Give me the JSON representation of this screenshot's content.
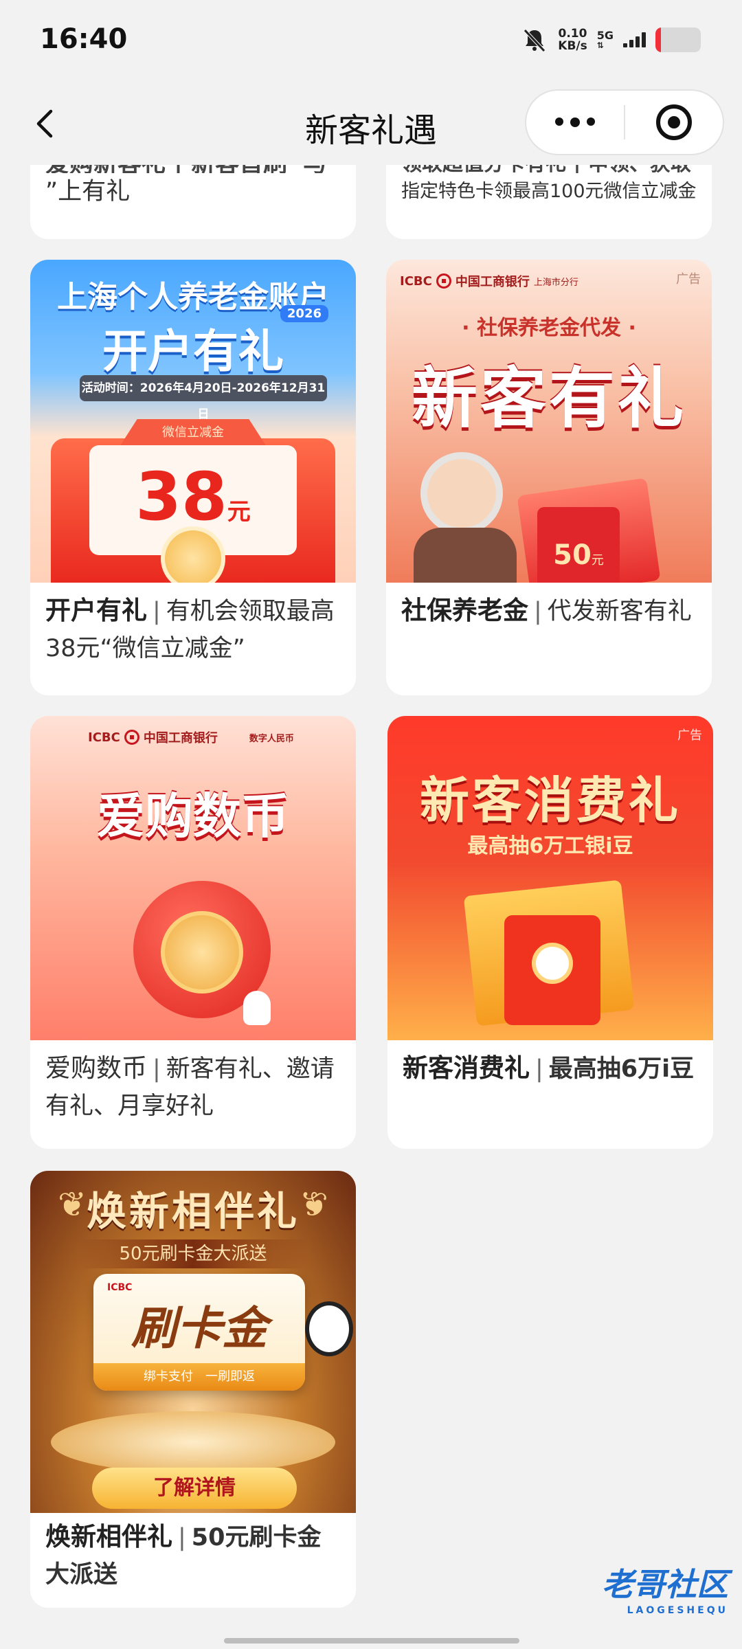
{
  "status_bar": {
    "time": "16:40",
    "net_speed_value": "0.10",
    "net_speed_unit": "KB/s",
    "network": "5G",
    "battery_level": 0.12,
    "battery_color": "#f2303a"
  },
  "nav": {
    "title": "新客礼遇",
    "back_icon": "chevron-left-icon",
    "more_icon": "more-dots-icon",
    "close_icon": "target-icon"
  },
  "cards": [
    {
      "id": "top-left-partial",
      "caption_text": "”上有礼",
      "partial_top": "爱购新客礼 | 新客首刷“与"
    },
    {
      "id": "top-right-partial",
      "caption_text": "指定特色卡领最高100元微信立减金",
      "partial_top": "领取超值分卡有礼 | 申领、获取"
    },
    {
      "id": "pension-account",
      "banner": {
        "title_line1": "上海个人养老金账户",
        "year": "2026",
        "title_line2": "开户有礼",
        "period": "活动时间：2026年4月20日-2026年12月31日",
        "ribbon": "微信立减金",
        "amount": "38",
        "unit": "元"
      },
      "caption_bold": "开户有礼",
      "caption_rest": "有机会领取最高38元“微信立减金”"
    },
    {
      "id": "social-pension",
      "banner": {
        "bank": "中国工商银行",
        "bank_en": "ICBC",
        "branch": "上海市分行",
        "ad": "广告",
        "subtitle": "· 社保养老金代发 ·",
        "title": "新客有礼",
        "amount": "50",
        "unit": "元"
      },
      "caption_bold": "社保养老金",
      "caption_rest": "代发新客有礼"
    },
    {
      "id": "digital-rmb",
      "banner": {
        "bank": "中国工商银行",
        "bank_en": "ICBC",
        "partner": "数字人民币",
        "title": "爱购数币"
      },
      "caption_bold": "爱购数币",
      "caption_rest": "新客有礼、邀请有礼、月享好礼"
    },
    {
      "id": "new-customer-consume",
      "banner": {
        "ad": "广告",
        "title": "新客消费礼",
        "subtitle": "最高抽6万工银i豆"
      },
      "caption_bold": "新客消费礼",
      "caption_rest": "最高抽6万i豆"
    },
    {
      "id": "renew-gift",
      "banner": {
        "title": "焕新相伴礼",
        "subtitle": "50元刷卡金大派送",
        "card_bank": "ICBC",
        "card_title": "刷卡金",
        "card_sub": "绑卡支付　一刷即返",
        "cta": "了解详情"
      },
      "caption_bold": "焕新相伴礼",
      "caption_rest": "50元刷卡金大派送"
    }
  ],
  "watermark": {
    "text": "老哥社区",
    "sub": "LAOGESHEQU"
  },
  "colors": {
    "icbc_red": "#c8151d",
    "background": "#f2f2f2"
  }
}
